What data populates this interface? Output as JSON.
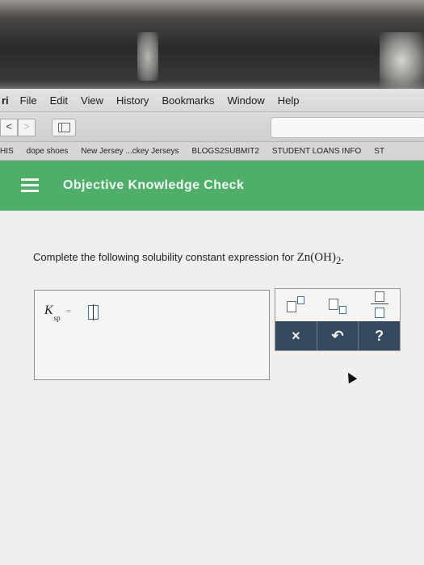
{
  "menubar": {
    "app": "ri",
    "items": [
      "File",
      "Edit",
      "View",
      "History",
      "Bookmarks",
      "Window",
      "Help"
    ]
  },
  "toolbar": {
    "back_label": "<",
    "forward_label": ">"
  },
  "bookmarks": [
    "HIS",
    "dope shoes",
    "New Jersey ...ckey Jerseys",
    "BLOGS2SUBMIT2",
    "STUDENT LOANS INFO",
    "ST"
  ],
  "header": {
    "title": "Objective Knowledge Check"
  },
  "question": {
    "text": "Complete the following solubility constant expression for ",
    "formula_main": "Zn(OH)",
    "formula_sub": "2",
    "period": "."
  },
  "answer": {
    "k_symbol": "K",
    "k_subscript": "sp",
    "equals": "="
  },
  "palette": {
    "clear_label": "×",
    "undo_label": "↶",
    "help_label": "?"
  }
}
